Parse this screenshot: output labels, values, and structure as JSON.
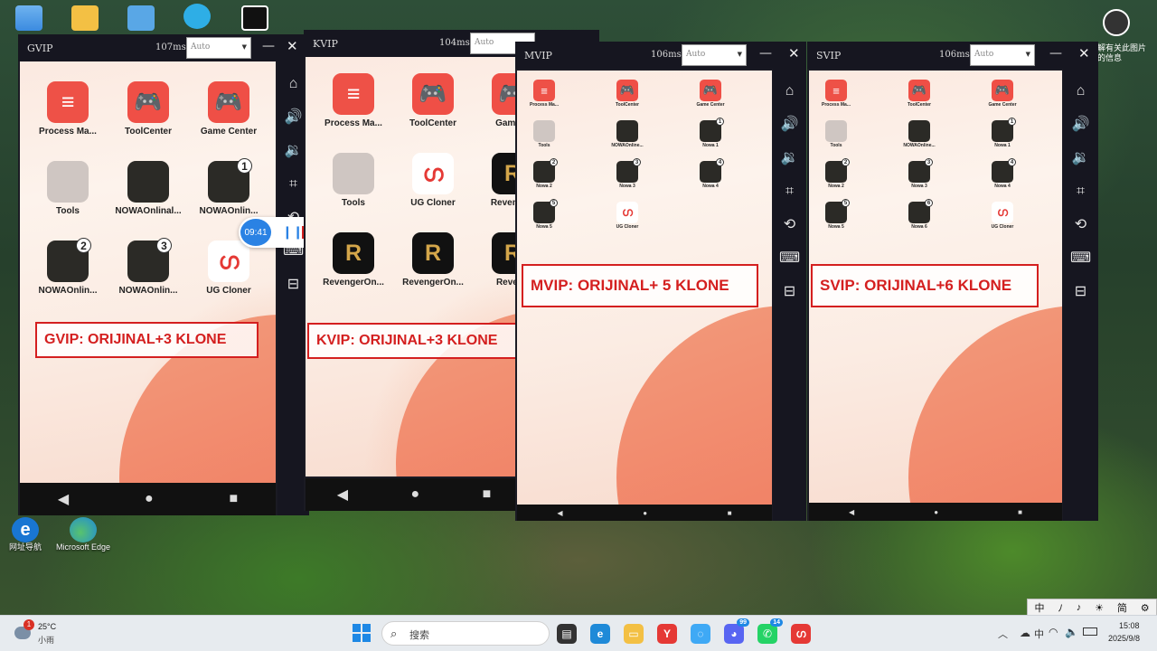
{
  "desktop": {
    "icons": [
      {
        "label": "",
        "color": "#3b8be0"
      },
      {
        "label": "",
        "color": "#f3c044"
      },
      {
        "label": "",
        "color": "#59a7e6"
      },
      {
        "label": "",
        "color": "#2eaee6"
      },
      {
        "label": "",
        "color": "#111111"
      }
    ],
    "bottom_icons": [
      {
        "label": "网址导航",
        "color": "#1976d2"
      },
      {
        "label": "Microsoft Edge",
        "color": "#1f8ad8"
      }
    ],
    "right_corner_text": "解有关此图片的信息"
  },
  "windows": [
    {
      "title": "GVIP",
      "ping": "107ms",
      "quality": "Auto",
      "apps": [
        {
          "label": "Process Ma...",
          "color": "#ee5147",
          "glyph": "≡",
          "badge": ""
        },
        {
          "label": "ToolCenter",
          "color": "#ef4f46",
          "glyph": "🎮",
          "badge": ""
        },
        {
          "label": "Game Center",
          "color": "#ef4f46",
          "glyph": "🎮",
          "badge": ""
        },
        {
          "label": "Tools",
          "color": "#cfc6c2",
          "glyph": "",
          "badge": ""
        },
        {
          "label": "NOWAOnlinal...",
          "color": "#2b2a26",
          "glyph": "",
          "badge": ""
        },
        {
          "label": "NOWAOnlin...",
          "color": "#2b2a26",
          "glyph": "",
          "badge": "1"
        },
        {
          "label": "NOWAOnlin...",
          "color": "#2b2a26",
          "glyph": "",
          "badge": "2"
        },
        {
          "label": "NOWAOnlin...",
          "color": "#2b2a26",
          "glyph": "",
          "badge": "3"
        },
        {
          "label": "UG Cloner",
          "color": "#ffffff",
          "glyph": "ഗ",
          "badge": ""
        }
      ],
      "banner": "GVIP: ORIJINAL+3 KLONE",
      "recorder": {
        "time": "09:41"
      }
    },
    {
      "title": "KVIP",
      "ping": "104ms",
      "quality": "Auto",
      "apps": [
        {
          "label": "Process Ma...",
          "color": "#ee5147",
          "glyph": "≡",
          "badge": ""
        },
        {
          "label": "ToolCenter",
          "color": "#ef4f46",
          "glyph": "🎮",
          "badge": ""
        },
        {
          "label": "Game C",
          "color": "#ef4f46",
          "glyph": "🎮",
          "badge": ""
        },
        {
          "label": "Tools",
          "color": "#cfc6c2",
          "glyph": "",
          "badge": ""
        },
        {
          "label": "UG Cloner",
          "color": "#ffffff",
          "glyph": "ഗ",
          "badge": ""
        },
        {
          "label": "Revengerl",
          "color": "#111111",
          "glyph": "R",
          "badge": ""
        },
        {
          "label": "RevengerOn...",
          "color": "#111111",
          "glyph": "R",
          "badge": ""
        },
        {
          "label": "RevengerOn...",
          "color": "#111111",
          "glyph": "R",
          "badge": ""
        },
        {
          "label": "Reveng",
          "color": "#111111",
          "glyph": "R",
          "badge": ""
        }
      ],
      "banner": "KVIP: ORIJINAL+3 KLONE"
    },
    {
      "title": "MVIP",
      "ping": "106ms",
      "quality": "Auto",
      "apps": [
        {
          "label": "Process Ma...",
          "color": "#ee5147",
          "glyph": "≡",
          "badge": ""
        },
        {
          "label": "ToolCenter",
          "color": "#ef4f46",
          "glyph": "🎮",
          "badge": ""
        },
        {
          "label": "Game Center",
          "color": "#ef4f46",
          "glyph": "🎮",
          "badge": ""
        },
        {
          "label": "Tools",
          "color": "#cfc6c2",
          "glyph": "",
          "badge": ""
        },
        {
          "label": "NOWAOnline...",
          "color": "#2b2a26",
          "glyph": "",
          "badge": ""
        },
        {
          "label": "Nowa 1",
          "color": "#2b2a26",
          "glyph": "",
          "badge": "1"
        },
        {
          "label": "Nowa 2",
          "color": "#2b2a26",
          "glyph": "",
          "badge": "2"
        },
        {
          "label": "Nowa 3",
          "color": "#2b2a26",
          "glyph": "",
          "badge": "3"
        },
        {
          "label": "Nowa 4",
          "color": "#2b2a26",
          "glyph": "",
          "badge": "4"
        },
        {
          "label": "Nowa 5",
          "color": "#2b2a26",
          "glyph": "",
          "badge": "5"
        },
        {
          "label": "UG Cloner",
          "color": "#ffffff",
          "glyph": "ഗ",
          "badge": ""
        }
      ],
      "banner": "MVIP: ORIJINAL+ 5 KLONE"
    },
    {
      "title": "SVIP",
      "ping": "106ms",
      "quality": "Auto",
      "apps": [
        {
          "label": "Process Ma...",
          "color": "#ee5147",
          "glyph": "≡",
          "badge": ""
        },
        {
          "label": "ToolCenter",
          "color": "#ef4f46",
          "glyph": "🎮",
          "badge": ""
        },
        {
          "label": "Game Center",
          "color": "#ef4f46",
          "glyph": "🎮",
          "badge": ""
        },
        {
          "label": "Tools",
          "color": "#cfc6c2",
          "glyph": "",
          "badge": ""
        },
        {
          "label": "NOWAOnline...",
          "color": "#2b2a26",
          "glyph": "",
          "badge": ""
        },
        {
          "label": "Nowa 1",
          "color": "#2b2a26",
          "glyph": "",
          "badge": "1"
        },
        {
          "label": "Nowa 2",
          "color": "#2b2a26",
          "glyph": "",
          "badge": "2"
        },
        {
          "label": "Nowa 3",
          "color": "#2b2a26",
          "glyph": "",
          "badge": "3"
        },
        {
          "label": "Nowa 4",
          "color": "#2b2a26",
          "glyph": "",
          "badge": "4"
        },
        {
          "label": "Nowa 5",
          "color": "#2b2a26",
          "glyph": "",
          "badge": "5"
        },
        {
          "label": "Nowa 6",
          "color": "#2b2a26",
          "glyph": "",
          "badge": "6"
        },
        {
          "label": "UG Cloner",
          "color": "#ffffff",
          "glyph": "ഗ",
          "badge": ""
        }
      ],
      "banner": "SVIP: ORIJINAL+6 KLONE"
    }
  ],
  "sidebar_icons": [
    "home-icon",
    "volume-up-icon",
    "volume-down-icon",
    "crop-icon",
    "rotate-icon",
    "keyboard-icon",
    "router-icon"
  ],
  "taskbar": {
    "weather_temp": "25°C",
    "weather_desc": "小雨",
    "weather_badge": "1",
    "search_placeholder": "搜索",
    "pinned": [
      {
        "name": "file-icon",
        "color": "#333333"
      },
      {
        "name": "edge-icon",
        "color": "#1f8ad8"
      },
      {
        "name": "folder-icon",
        "color": "#f3c044"
      },
      {
        "name": "yandex-icon",
        "color": "#e53935"
      },
      {
        "name": "chat-icon",
        "color": "#3fa9f5"
      },
      {
        "name": "discord-icon",
        "color": "#5865f2"
      },
      {
        "name": "whatsapp-icon",
        "color": "#25d366"
      },
      {
        "name": "ug-icon",
        "color": "#e53935"
      }
    ],
    "badges": {
      "discord": "99",
      "whatsapp": "14"
    },
    "clock_time": "15:08",
    "clock_date": "2025/9/8",
    "ime": "中"
  },
  "ime_bar": [
    "中",
    "ﾉ",
    "♪",
    "☀",
    "简",
    "⚙"
  ]
}
